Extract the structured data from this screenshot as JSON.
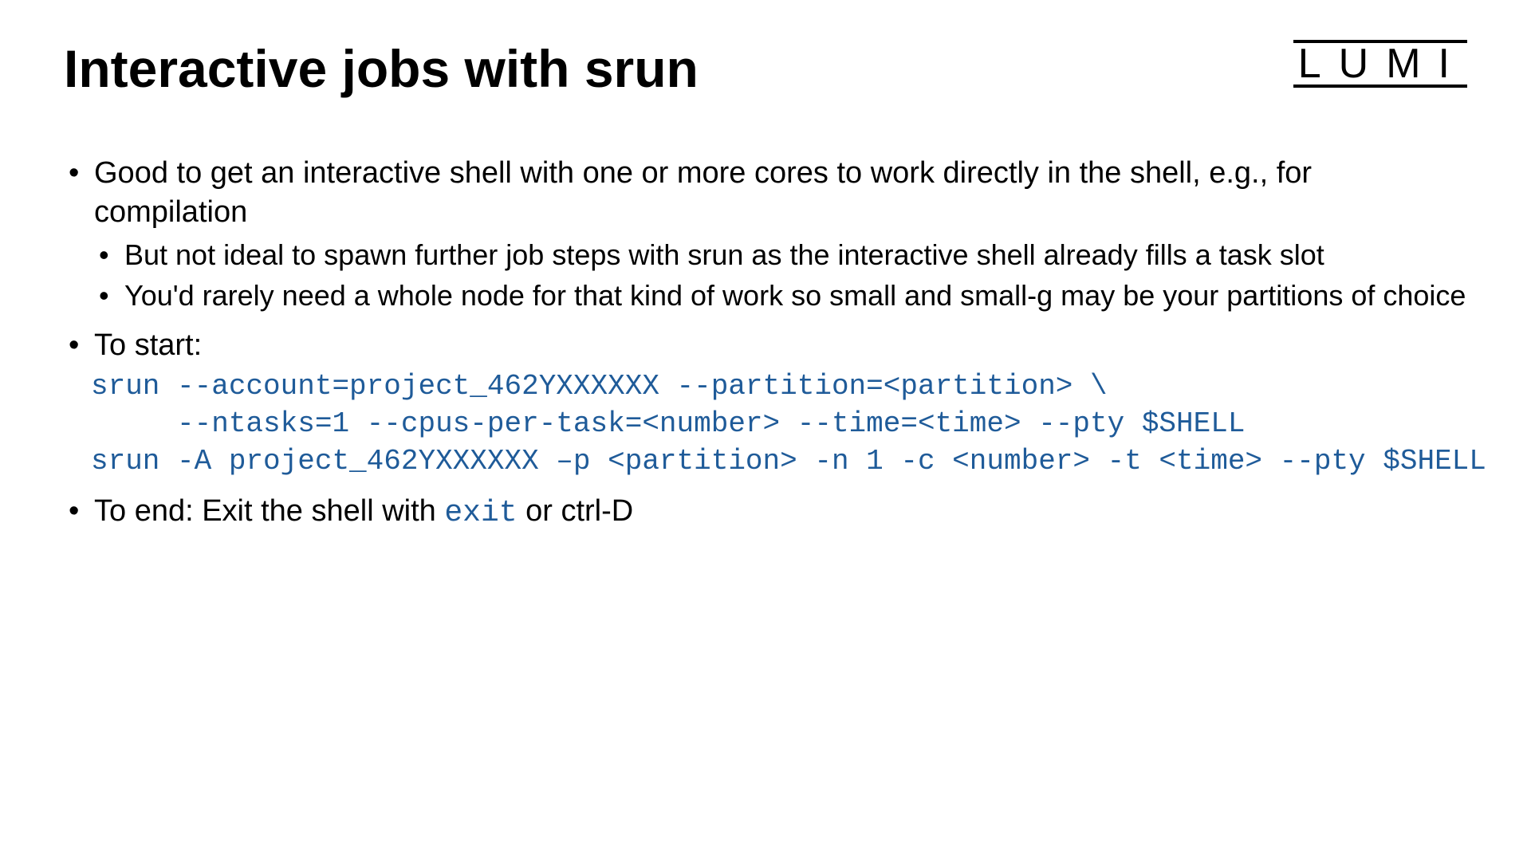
{
  "logo": "LUMI",
  "title": "Interactive jobs with srun",
  "bullets": {
    "b1": "Good to get an interactive shell with one or more cores to work directly in the shell, e.g., for compilation",
    "b1a": "But not ideal to spawn further job steps with srun as the interactive shell already fills a task slot",
    "b1b": "You'd rarely need a whole node for that kind of work so small and small-g may be your partitions of choice",
    "b2": "To start:",
    "b3_pre": "To end: Exit the shell with ",
    "b3_code": "exit",
    "b3_post": " or ctrl-D"
  },
  "code": {
    "line1": "srun --account=project_462YXXXXXX --partition=<partition> \\",
    "line2": "     --ntasks=1 --cpus-per-task=<number> --time=<time> --pty $SHELL",
    "line3": "srun -A project_462YXXXXXX –p <partition> -n 1 -c <number> -t <time> --pty $SHELL"
  }
}
